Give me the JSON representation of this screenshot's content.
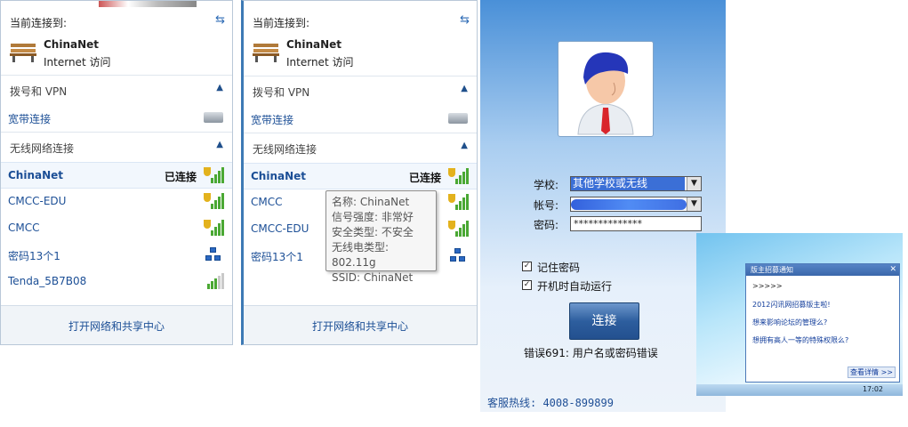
{
  "panel1": {
    "current_label": "当前连接到:",
    "connection_name": "ChinaNet",
    "connection_sub": "Internet 访问",
    "dialup_section": "拨号和 VPN",
    "broadband": "宽带连接",
    "wireless_section": "无线网络连接",
    "networks": [
      {
        "name": "ChinaNet",
        "status": "已连接",
        "secured": true,
        "bars": 5
      },
      {
        "name": "CMCC-EDU",
        "status": "",
        "secured": true,
        "bars": 5
      },
      {
        "name": "CMCC",
        "status": "",
        "secured": true,
        "bars": 5
      },
      {
        "name": "密码13个1",
        "status": "",
        "secured": false,
        "bars": 0
      },
      {
        "name": "Tenda_5B7B08",
        "status": "",
        "secured": false,
        "bars": 3
      }
    ],
    "footer_link": "打开网络和共享中心"
  },
  "panel2": {
    "current_label": "当前连接到:",
    "connection_name": "ChinaNet",
    "connection_sub": "Internet 访问",
    "dialup_section": "拨号和 VPN",
    "broadband": "宽带连接",
    "wireless_section": "无线网络连接",
    "networks": [
      {
        "name": "ChinaNet",
        "status": "已连接"
      },
      {
        "name": "CMCC",
        "status": ""
      },
      {
        "name": "CMCC-EDU",
        "status": ""
      },
      {
        "name": "密码13个1",
        "status": ""
      }
    ],
    "footer_link": "打开网络和共享中心"
  },
  "tooltip": {
    "lines": [
      "名称: ChinaNet",
      "信号强度: 非常好",
      "安全类型: 不安全",
      "无线电类型: 802.11g",
      "SSID: ChinaNet"
    ]
  },
  "client": {
    "school_label": "学校:",
    "school_value": "其他学校或无线",
    "account_label": "帐号:",
    "password_label": "密码:",
    "password_value": "**************",
    "remember_label": "记住密码",
    "autorun_label": "开机时自动运行",
    "connect_button": "连接",
    "error_text": "错误691: 用户名或密码错误",
    "hotline": "客服热线: 4008-899899"
  },
  "popup": {
    "title": "版主招募通知",
    "lines": [
      ">>>>>",
      "2012闪讯网招募版主啦!",
      "想来影响论坛的管理么?",
      "想拥有高人一等的特殊权限么?"
    ],
    "more": "查看详情 >>",
    "clock": "17:02"
  }
}
